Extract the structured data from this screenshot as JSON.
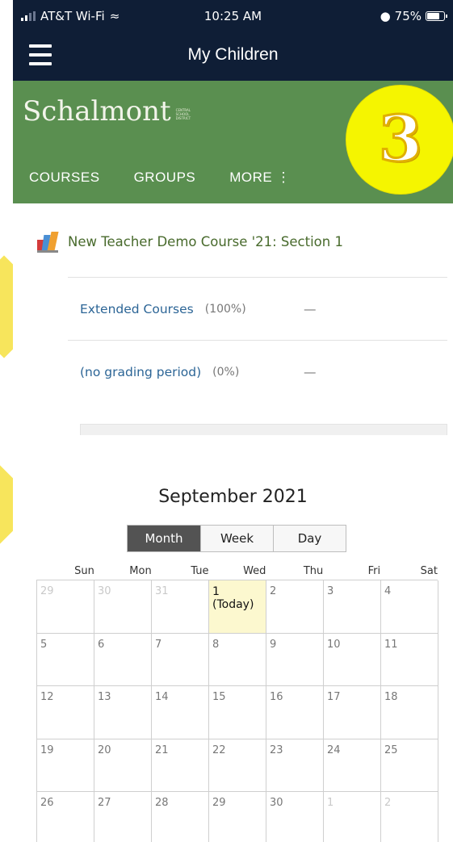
{
  "status_bar": {
    "carrier": "AT&T Wi-Fi",
    "time": "10:25 AM",
    "battery": "75%"
  },
  "nav": {
    "title": "My Children"
  },
  "school": {
    "logo_text": "Schalmont",
    "logo_tag": "CENTRAL SCHOOL DISTRICT",
    "tabs": [
      "COURSES",
      "GROUPS",
      "MORE ⋮"
    ],
    "accent_color": "#5a8f50"
  },
  "annotation": {
    "step_number": "3"
  },
  "course": {
    "title": "New Teacher Demo Course '21: Section 1",
    "grading_periods": [
      {
        "name": "Extended Courses",
        "percent": "(100%)",
        "grade": "—"
      },
      {
        "name": "(no grading period)",
        "percent": "(0%)",
        "grade": "—"
      }
    ]
  },
  "calendar": {
    "title": "September 2021",
    "views": [
      "Month",
      "Week",
      "Day"
    ],
    "selected_view": "Month",
    "weekdays": [
      "Sun",
      "Mon",
      "Tue",
      "Wed",
      "Thu",
      "Fri",
      "Sat"
    ],
    "weeks": [
      [
        {
          "label": "29",
          "other": true
        },
        {
          "label": "30",
          "other": true
        },
        {
          "label": "31",
          "other": true
        },
        {
          "label": "1 (Today)",
          "today": true
        },
        {
          "label": "2"
        },
        {
          "label": "3"
        },
        {
          "label": "4"
        }
      ],
      [
        {
          "label": "5"
        },
        {
          "label": "6"
        },
        {
          "label": "7"
        },
        {
          "label": "8"
        },
        {
          "label": "9"
        },
        {
          "label": "10"
        },
        {
          "label": "11"
        }
      ],
      [
        {
          "label": "12"
        },
        {
          "label": "13"
        },
        {
          "label": "14"
        },
        {
          "label": "15"
        },
        {
          "label": "16"
        },
        {
          "label": "17"
        },
        {
          "label": "18"
        }
      ],
      [
        {
          "label": "19"
        },
        {
          "label": "20"
        },
        {
          "label": "21"
        },
        {
          "label": "22"
        },
        {
          "label": "23"
        },
        {
          "label": "24"
        },
        {
          "label": "25"
        }
      ],
      [
        {
          "label": "26"
        },
        {
          "label": "27"
        },
        {
          "label": "28"
        },
        {
          "label": "29"
        },
        {
          "label": "30"
        },
        {
          "label": "1",
          "other": true
        },
        {
          "label": "2",
          "other": true
        }
      ]
    ]
  }
}
